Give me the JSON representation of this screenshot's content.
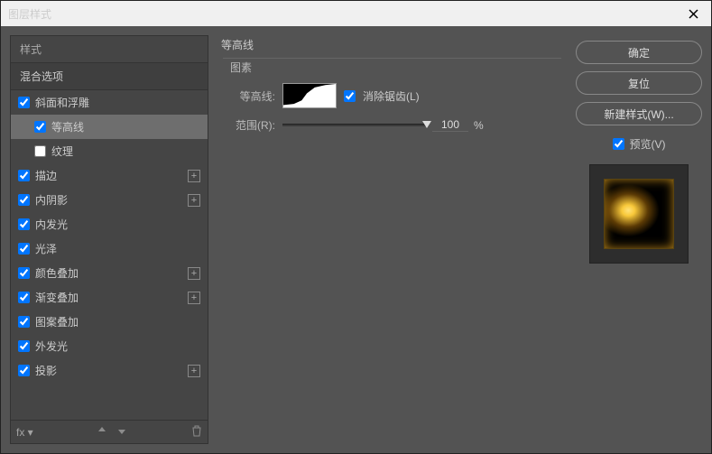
{
  "window": {
    "title": "图层样式"
  },
  "sidebar": {
    "header": "样式",
    "subheader": "混合选项",
    "items": [
      {
        "label": "斜面和浮雕",
        "checked": true,
        "plus": false,
        "indent": false
      },
      {
        "label": "等高线",
        "checked": true,
        "plus": false,
        "indent": true,
        "selected": true
      },
      {
        "label": "纹理",
        "checked": false,
        "plus": false,
        "indent": true
      },
      {
        "label": "描边",
        "checked": true,
        "plus": true,
        "indent": false
      },
      {
        "label": "内阴影",
        "checked": true,
        "plus": true,
        "indent": false
      },
      {
        "label": "内发光",
        "checked": true,
        "plus": false,
        "indent": false
      },
      {
        "label": "光泽",
        "checked": true,
        "plus": false,
        "indent": false
      },
      {
        "label": "颜色叠加",
        "checked": true,
        "plus": true,
        "indent": false
      },
      {
        "label": "渐变叠加",
        "checked": true,
        "plus": true,
        "indent": false
      },
      {
        "label": "图案叠加",
        "checked": true,
        "plus": false,
        "indent": false
      },
      {
        "label": "外发光",
        "checked": true,
        "plus": false,
        "indent": false
      },
      {
        "label": "投影",
        "checked": true,
        "plus": true,
        "indent": false
      }
    ]
  },
  "content": {
    "title": "等高线",
    "section": "图素",
    "contour_label": "等高线:",
    "antialias_label": "消除锯齿(L)",
    "antialias_checked": true,
    "range_label": "范围(R):",
    "range_value": "100",
    "range_unit": "%"
  },
  "actions": {
    "ok": "确定",
    "reset": "复位",
    "new_style": "新建样式(W)...",
    "preview_label": "预览(V)",
    "preview_checked": true
  }
}
